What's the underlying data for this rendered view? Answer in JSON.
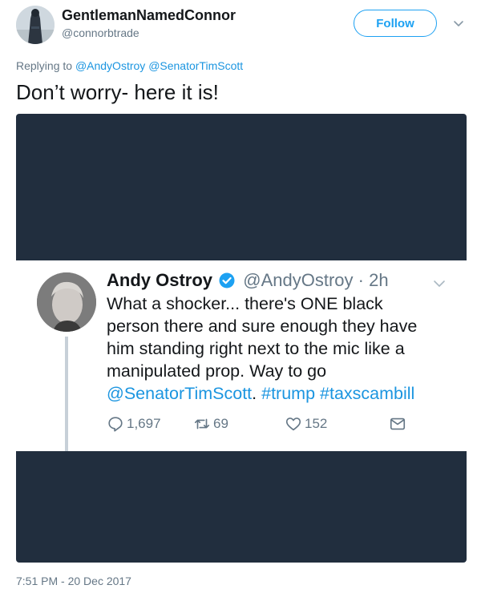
{
  "header": {
    "display_name": "GentlemanNamedConnor",
    "handle": "@connorbtrade",
    "follow_label": "Follow"
  },
  "reply": {
    "prefix": "Replying to",
    "mentions": [
      "@AndyOstroy",
      "@SenatorTimScott"
    ]
  },
  "tweet": {
    "text": "Don’t worry- here it is!",
    "timestamp": "7:51 PM - 20 Dec 2017"
  },
  "embedded_tweet": {
    "name": "Andy Ostroy",
    "handle": "@AndyOstroy",
    "dot": "·",
    "time": "2h",
    "lines": [
      "What a shocker... there's ONE black",
      "person there and sure enough they have",
      "him standing right next to the mic like a",
      "manipulated prop. Way to go"
    ],
    "last_line": {
      "mention": "@SenatorTimScott",
      "period": ".",
      "hashtag1": "#trump",
      "hashtag2": "#taxscambill"
    },
    "replies": "1,697",
    "retweets": "69",
    "likes": "152"
  },
  "colors": {
    "accent": "#1da1f2",
    "link": "#1b95e0",
    "muted": "#657786",
    "media_bg": "#212e3e"
  },
  "icons": [
    "chevron-down-icon",
    "verified-badge-icon",
    "reply-icon",
    "retweet-icon",
    "like-icon",
    "message-icon"
  ]
}
